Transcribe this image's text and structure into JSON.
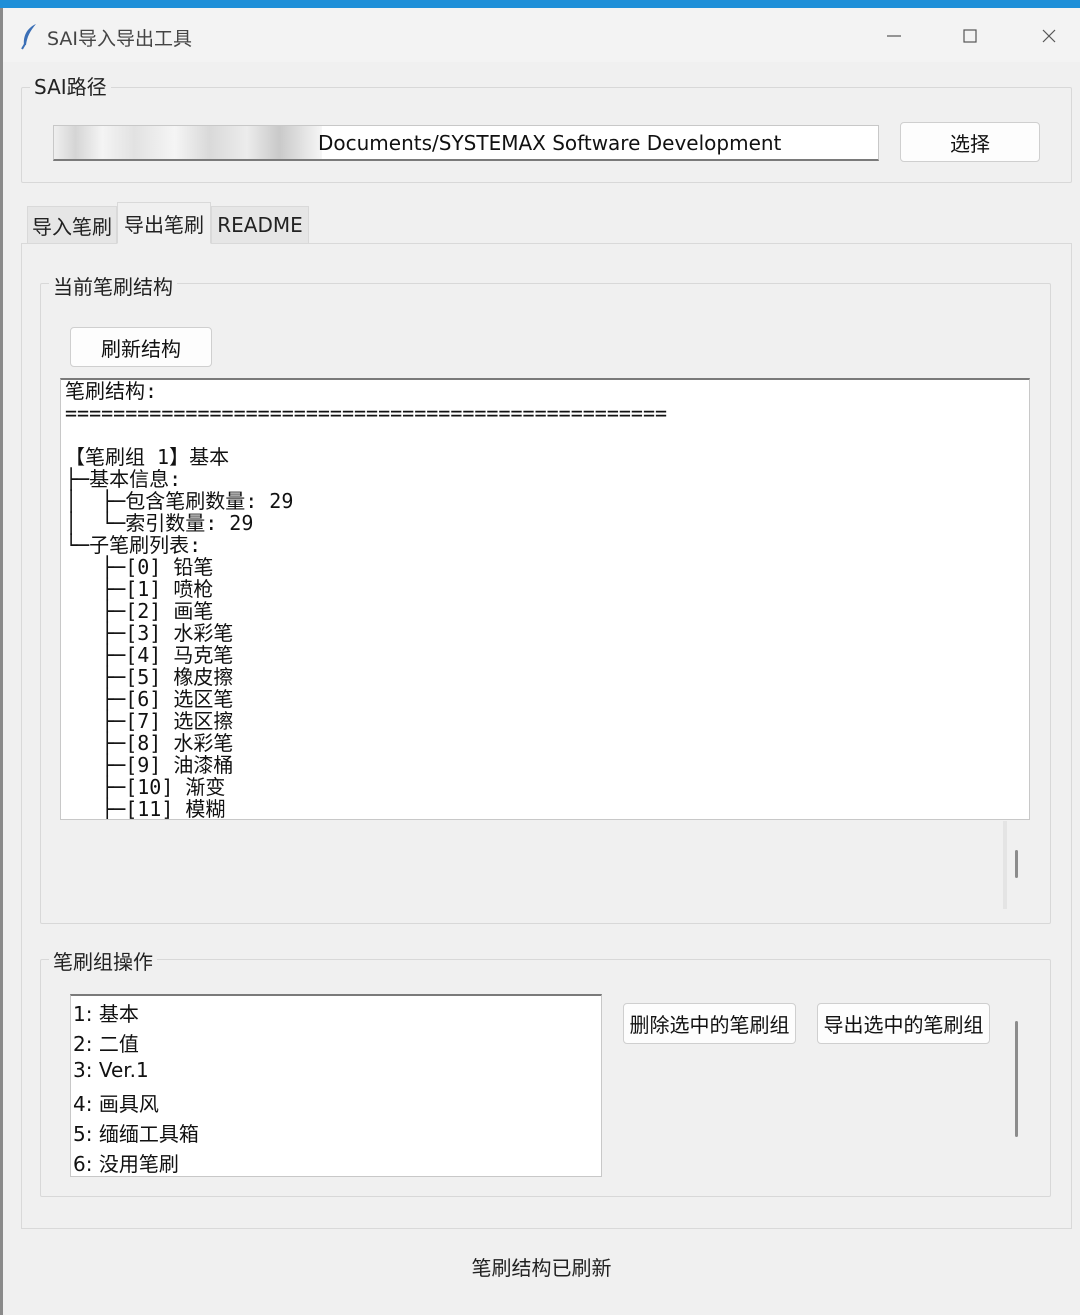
{
  "window": {
    "title": "SAI导入导出工具",
    "icons": {
      "app": "feather-icon",
      "minimize": "minimize-icon",
      "maximize": "maximize-icon",
      "close": "close-icon"
    }
  },
  "path_section": {
    "label": "SAI路径",
    "value": "Documents/SYSTEMAX Software Development",
    "select_label": "选择"
  },
  "tabs": [
    {
      "label": "导入笔刷",
      "selected": false
    },
    {
      "label": "导出笔刷",
      "selected": true
    },
    {
      "label": "README",
      "selected": false
    }
  ],
  "structure_section": {
    "label": "当前笔刷结构",
    "refresh_label": "刷新结构",
    "lines": [
      "笔刷结构:",
      "==================================================",
      "",
      "【笔刷组 1】基本",
      "├─基本信息:",
      "│  ├─包含笔刷数量: 29",
      "│  └─索引数量: 29",
      "└─子笔刷列表:",
      "   ├─[0] 铅笔",
      "   ├─[1] 喷枪",
      "   ├─[2] 画笔",
      "   ├─[3] 水彩笔",
      "   ├─[4] 马克笔",
      "   ├─[5] 橡皮擦",
      "   ├─[6] 选区笔",
      "   ├─[7] 选区擦",
      "   ├─[8] 水彩笔",
      "   ├─[9] 油漆桶",
      "   ├─[10] 渐变",
      "   ├─[11] 模糊"
    ]
  },
  "ops_section": {
    "label": "笔刷组操作",
    "groups": [
      "1: 基本",
      "2: 二值",
      "3: Ver.1",
      "4: 画具风",
      "5: 缅缅工具箱",
      "6: 没用笔刷"
    ],
    "delete_label": "删除选中的笔刷组",
    "export_label": "导出选中的笔刷组"
  },
  "status": "笔刷结构已刷新"
}
